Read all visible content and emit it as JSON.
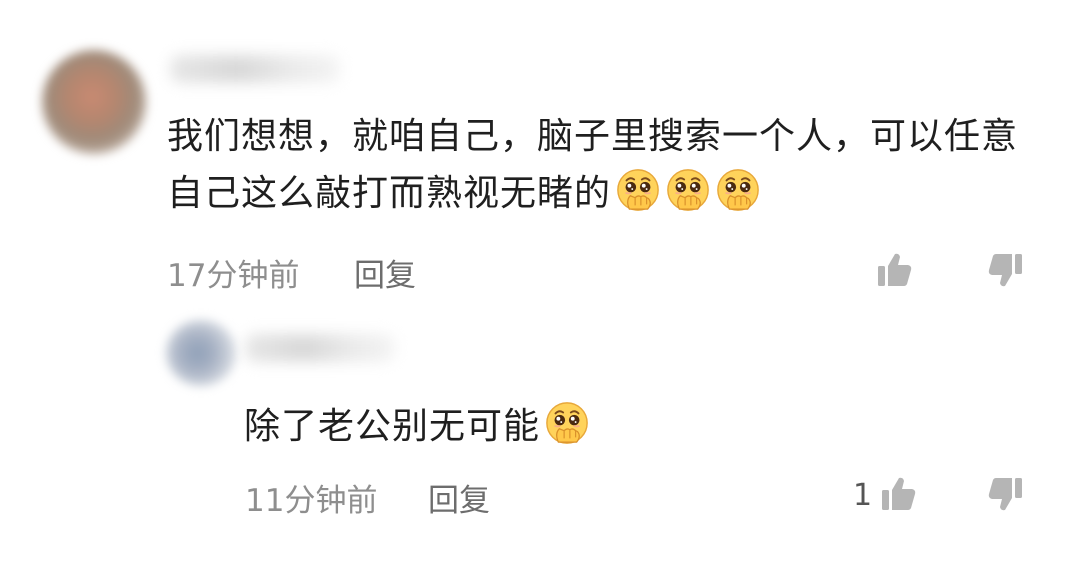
{
  "comments": [
    {
      "text": "我们想想，就咱自己，脑子里搜索一个人，可以任意自己这么敲打而熟视无睹的",
      "emoji_count": 3,
      "emoji": "pleading-cover-mouth-emoji",
      "time": "17分钟前",
      "reply_label": "回复",
      "like_count": ""
    }
  ],
  "reply": {
    "text": "除了老公别无可能",
    "emoji_count": 1,
    "emoji": "pleading-cover-mouth-emoji",
    "time": "11分钟前",
    "reply_label": "回复",
    "like_count": "1"
  },
  "colors": {
    "text": "#1f1f1f",
    "meta": "#8e8e8e",
    "icon": "#b5b5b5",
    "emoji_face": "#ffd25a"
  },
  "icons": [
    "thumbs-up-icon",
    "thumbs-down-icon"
  ]
}
